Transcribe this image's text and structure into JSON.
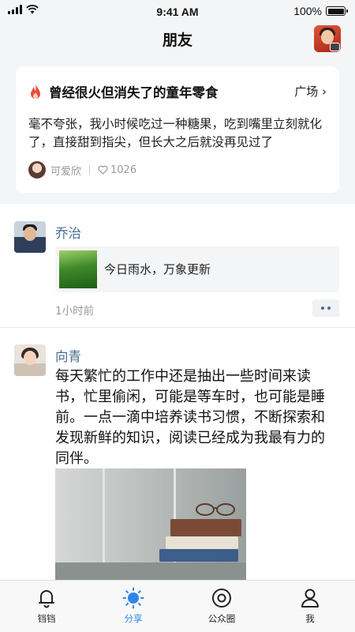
{
  "status_bar": {
    "time": "9:41 AM",
    "battery": "100%",
    "battery_level": 1.0
  },
  "header": {
    "title": "朋友"
  },
  "topic": {
    "title": "曾经很火但消失了的童年零食",
    "link": "广场 ›",
    "body": "毫不夸张，我小时候吃过一种糖果，吃到嘴里立刻就化了，直接甜到指尖，但长大之后就没再见过了",
    "author": "可爱欣",
    "likes": "1026"
  },
  "posts": [
    {
      "name": "乔治",
      "share_text": "今日雨水，万象更新",
      "time": "1小时前"
    },
    {
      "name": "向青",
      "text": "每天繁忙的工作中还是抽出一些时间来读书，忙里偷闲，可能是等车时，也可能是睡前。一点一滴中培养读书习惯，不断探索和发现新鲜的知识，阅读已经成为我最有力的同伴。"
    }
  ],
  "tabs": [
    {
      "label": "铛铛",
      "icon": "bell-icon"
    },
    {
      "label": "分享",
      "icon": "sun-icon"
    },
    {
      "label": "公众圈",
      "icon": "target-icon"
    },
    {
      "label": "我",
      "icon": "person-icon"
    }
  ],
  "colors": {
    "accent": "#2f86e8",
    "username": "#4a6c93",
    "fire": "#ef4b3a"
  }
}
